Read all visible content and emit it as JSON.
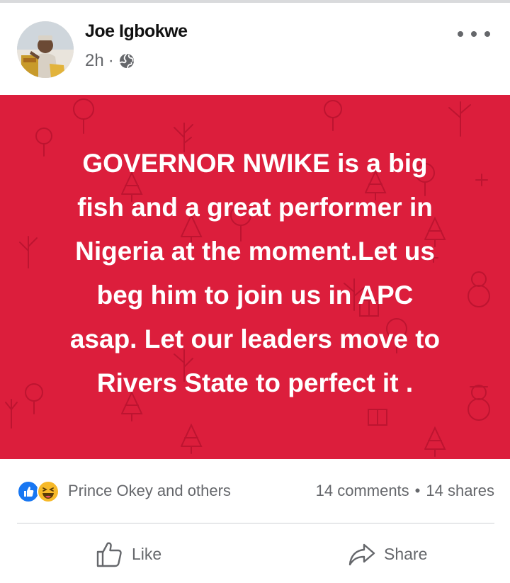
{
  "post": {
    "author": "Joe Igbokwe",
    "time": "2h",
    "separator": "·",
    "visibility_icon": "globe-icon",
    "more_icon": "more-options-icon"
  },
  "content": {
    "background_color": "#dc1e3c",
    "text_color": "#ffffff",
    "lines": [
      "GOVERNOR NWIKE is a big",
      "fish and a great performer in",
      "Nigeria at the moment.Let us",
      "beg him to join us in APC",
      "asap. Let our leaders move to",
      "Rivers State to perfect it ."
    ]
  },
  "engagement": {
    "reactions": [
      "like-reaction-icon",
      "haha-reaction-icon"
    ],
    "reactors": "Prince Okey and others",
    "comments": "14 comments",
    "dot": "•",
    "shares": "14 shares"
  },
  "actions": {
    "like": "Like",
    "share": "Share"
  },
  "colors": {
    "facebook_blue": "#1877f2",
    "meta_gray": "#65676b",
    "haha_yellow": "#f7b928"
  }
}
